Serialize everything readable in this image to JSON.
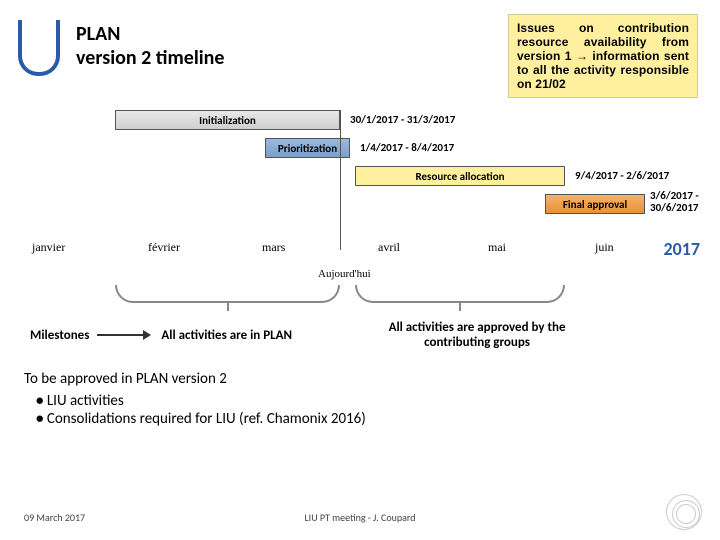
{
  "title_line1": "PLAN",
  "title_line2": "version 2 timeline",
  "callout": "Issues on contribution resource availability from version 1 → information sent to all the activity responsible on 21/02",
  "bars": {
    "init": "Initialization",
    "prio": "Prioritization",
    "res": "Resource allocation",
    "final": "Final approval"
  },
  "ranges": {
    "init": "30/1/2017 - 31/3/2017",
    "prio": "1/4/2017 - 8/4/2017",
    "res": "9/4/2017 - 2/6/2017",
    "final": "3/6/2017 - 30/6/2017"
  },
  "months": [
    "janvier",
    "février",
    "mars",
    "avril",
    "mai",
    "juin"
  ],
  "year": "2017",
  "today": "Aujourd'hui",
  "milestones_label": "Milestones",
  "milestone1": "All activities are in PLAN",
  "milestone2": "All activities are approved by the contributing groups",
  "approved_heading": "To be approved in PLAN version 2",
  "approved_items": [
    "LIU activities",
    "Consolidations required for LIU (ref. Chamonix 2016)"
  ],
  "footer_date": "09 March 2017",
  "footer_mid": "LIU PT meeting - J. Coupard"
}
